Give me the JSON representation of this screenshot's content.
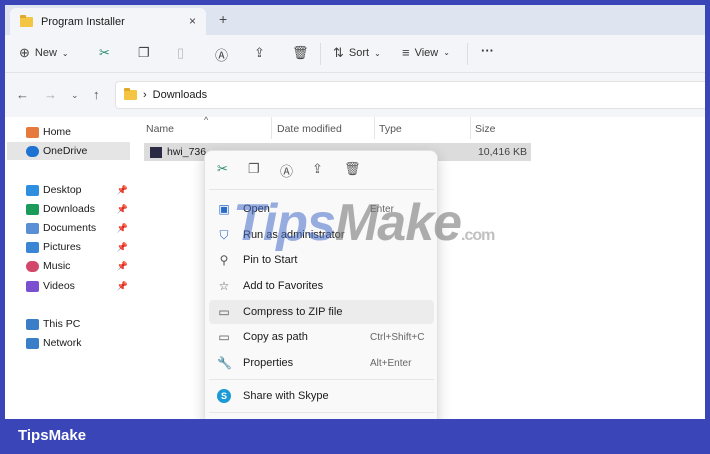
{
  "window": {
    "tab_title": "Program Installer",
    "close": "×",
    "new_tab": "+"
  },
  "toolbar": {
    "new": "New",
    "sort": "Sort",
    "view": "View",
    "more": "···"
  },
  "address": {
    "path": "Downloads",
    "sep": "›"
  },
  "sidebar": {
    "items": [
      {
        "label": "Home",
        "color": "#e57a3c"
      },
      {
        "label": "OneDrive",
        "color": "#1e73d2"
      },
      {
        "label": "Desktop",
        "color": "#2e8fe0"
      },
      {
        "label": "Downloads",
        "color": "#1a9b5a"
      },
      {
        "label": "Documents",
        "color": "#5a8fd6"
      },
      {
        "label": "Pictures",
        "color": "#3a86d4"
      },
      {
        "label": "Music",
        "color": "#d2486a"
      },
      {
        "label": "Videos",
        "color": "#7a4fd0"
      },
      {
        "label": "This PC",
        "color": "#3a7ec8"
      },
      {
        "label": "Network",
        "color": "#3a7ec8"
      }
    ]
  },
  "columns": {
    "name": "Name",
    "date": "Date modified",
    "type": "Type",
    "size": "Size"
  },
  "file": {
    "name": "hwi_736",
    "size": "10,416 KB"
  },
  "menu": {
    "items": [
      {
        "label": "Open",
        "shortcut": "Enter",
        "icon": "▣"
      },
      {
        "label": "Run as administrator",
        "shortcut": "",
        "icon": "⛉"
      },
      {
        "label": "Pin to Start",
        "shortcut": "",
        "icon": "⚲"
      },
      {
        "label": "Add to Favorites",
        "shortcut": "",
        "icon": "☆"
      },
      {
        "label": "Compress to ZIP file",
        "shortcut": "",
        "icon": "▭"
      },
      {
        "label": "Copy as path",
        "shortcut": "Ctrl+Shift+C",
        "icon": "▭"
      },
      {
        "label": "Properties",
        "shortcut": "Alt+Enter",
        "icon": "🔧"
      },
      {
        "label": "Share with Skype",
        "shortcut": "",
        "icon": "S"
      }
    ]
  },
  "watermark": {
    "a": "Tips",
    "b": "Make",
    ".com": ".com"
  },
  "brand": "TipsMake"
}
